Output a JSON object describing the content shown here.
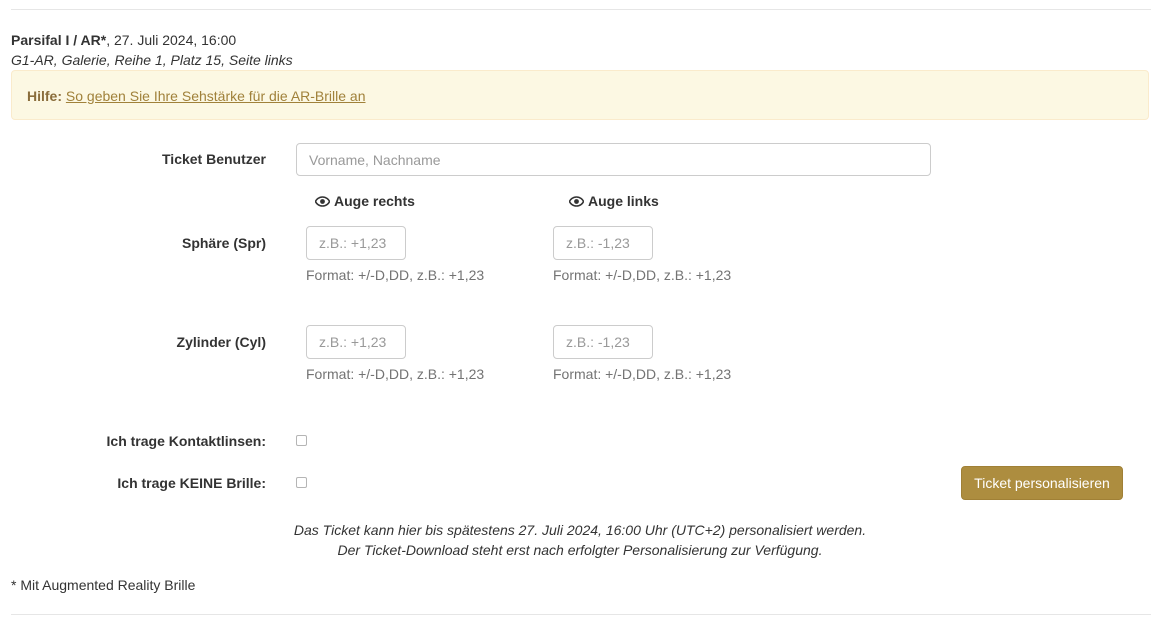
{
  "header": {
    "event_title": "Parsifal I / AR*",
    "event_date": ", 27. Juli 2024, 16:00",
    "seat_info": "G1-AR, Galerie, Reihe 1, Platz 15, Seite links"
  },
  "help": {
    "label": "Hilfe:",
    "link_text": "So geben Sie Ihre Sehstärke für die AR-Brille an"
  },
  "form": {
    "ticket_user_label": "Ticket Benutzer",
    "ticket_user_placeholder": "Vorname, Nachname",
    "ticket_user_value": "",
    "eye_right_label": "Auge rechts",
    "eye_left_label": "Auge links",
    "sphere_label": "Sphäre (Spr)",
    "cylinder_label": "Zylinder (Cyl)",
    "sphere_right_placeholder": "z.B.: +1,23",
    "sphere_left_placeholder": "z.B.: -1,23",
    "cylinder_right_placeholder": "z.B.: +1,23",
    "cylinder_left_placeholder": "z.B.: -1,23",
    "format_hint": "Format: +/-D,DD, z.B.: +1,23",
    "contact_lenses_label": "Ich trage Kontaktlinsen:",
    "contact_lenses_checked": false,
    "no_glasses_label": "Ich trage KEINE Brille:",
    "no_glasses_checked": false,
    "submit_label": "Ticket personalisieren"
  },
  "notes": {
    "line1": "Das Ticket kann hier bis spätestens 27. Juli 2024, 16:00 Uhr (UTC+2) personalisiert werden.",
    "line2": "Der Ticket-Download steht erst nach erfolgter Personalisierung zur Verfügung.",
    "footnote": "* Mit Augmented Reality Brille"
  },
  "colors": {
    "accent": "#ad8d3f",
    "help_background": "#fcf8e3",
    "help_text": "#8a6d3b",
    "link": "#a0813a"
  },
  "icons": {
    "eye": "eye-icon"
  }
}
